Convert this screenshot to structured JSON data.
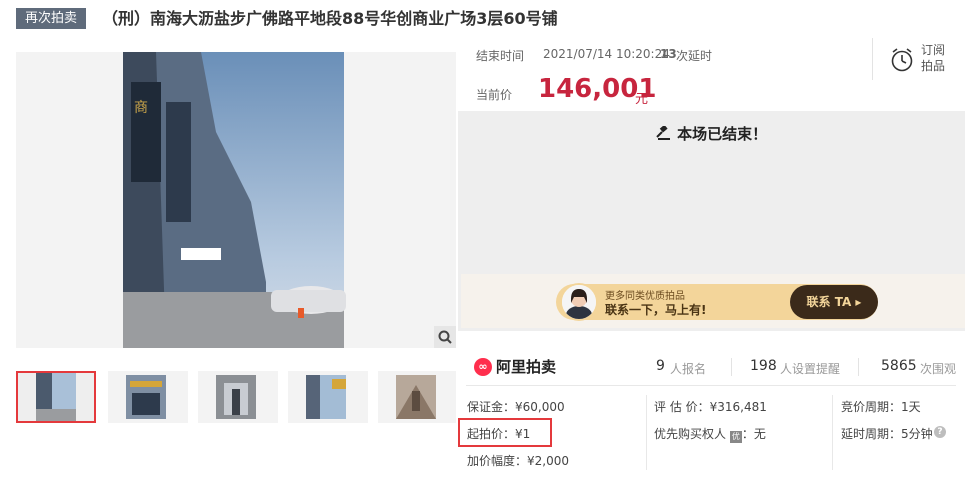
{
  "header": {
    "tag": "再次拍卖",
    "title": "（刑）南海大沥盐步广佛路平地段88号华创商业广场3层60号铺"
  },
  "auction": {
    "end_label": "结束时间",
    "end_time": "2021/07/14 10:20:24",
    "delay_count": "13",
    "delay_text": "次延时",
    "subscribe_line1": "订阅",
    "subscribe_line2": "拍品",
    "price_label": "当前价",
    "price": "146,001",
    "price_unit": "元",
    "ended_text": "本场已结束！"
  },
  "banner": {
    "line1": "更多同类优质拍品",
    "line2": "联系一下，马上有!",
    "cta": "联系 TA ▸"
  },
  "stats": {
    "logo_text": "阿里拍卖",
    "registered_num": "9",
    "registered_label": "人报名",
    "reminders_num": "198",
    "reminders_label": "人设置提醒",
    "views_num": "5865",
    "views_label": "次围观"
  },
  "info": {
    "deposit": "保证金：¥60,000",
    "start_price": "起拍价：¥1",
    "increment": "加价幅度：¥2,000",
    "appraisal": "评 估 价：¥316,481",
    "priority_label": "优先购买权人",
    "priority_badge": "优",
    "priority_value": "：无",
    "bid_cycle": "竞价周期：1天",
    "delay_cycle": "延时周期：5分钟"
  },
  "colors": {
    "accent_red": "#c7253e",
    "tag_bg": "#5f6b7b",
    "banner_gold": "#f3d59a"
  }
}
